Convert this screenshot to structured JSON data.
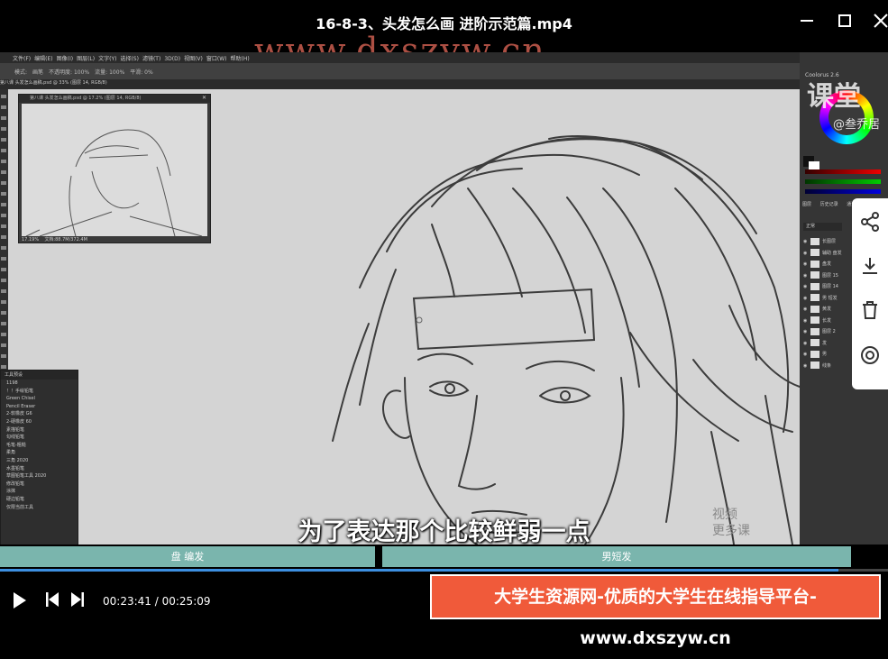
{
  "window": {
    "title": "16-8-3、头发怎么画 进阶示范篇.mp4",
    "minimize_icon": "minimize-icon",
    "maximize_icon": "maximize-icon",
    "close_icon": "close-icon"
  },
  "watermark_top": "www.dxszyw.cn",
  "app": {
    "menu": [
      "文件(F)",
      "编辑(E)",
      "图像(I)",
      "图层(L)",
      "文字(Y)",
      "选择(S)",
      "滤镜(T)",
      "3D(D)",
      "视图(V)",
      "窗口(W)",
      "帮助(H)"
    ],
    "options": [
      "模式:",
      "画笔",
      "不透明度: 100%",
      "流量: 100%",
      "平滑: 0%"
    ],
    "doc_tab": "第八课 头发怎么画稿.psd @ 33% (图层 14, RGB/8)",
    "navigator": {
      "title": "第八课 头发怎么画稿.psd @ 17.2% (图层 14, RGB/8)",
      "zoom": "17.19%",
      "doc_info": "文档:88.7M/372.4M"
    },
    "brush_panel": {
      "title": "工具预设",
      "items": [
        "1198",
        "！！手绘铅笔",
        "Green Chisel",
        "Pencil Eraser",
        "2-软橡皮 G6",
        "2-硬橡皮 60",
        "素描铅笔",
        "勾线铅笔",
        "毛笔-粗糙",
        "柔角",
        "三角 2020",
        "水墨铅笔",
        "草图铅笔工具 2020",
        "修改铅笔",
        "涂抹",
        "硬边铅笔",
        "仅限当前工具"
      ]
    },
    "right_panel": {
      "title": "Coolorus 2.6",
      "tabs": [
        "图层",
        "历史记录",
        "通道"
      ],
      "blend_mode": "正常",
      "layers": [
        "长图层",
        "辅助 盘发",
        "盘发",
        "图层 15",
        "图层 14",
        "男 短发",
        "黄发",
        "长发",
        "图层 2",
        "发",
        "男",
        "线条"
      ]
    }
  },
  "channel_logo": "课堂",
  "channel_handle": "@叁乔居",
  "side_buttons": [
    "share-icon",
    "download-icon",
    "delete-icon",
    "record-icon"
  ],
  "subtitle": "为了表达那个比较鲜弱一点",
  "corner_text": [
    "视频",
    "更多课"
  ],
  "chapters": [
    {
      "label": "盘 编发"
    },
    {
      "label": "男短发"
    }
  ],
  "player": {
    "progress": 0.944,
    "current_time": "00:23:41",
    "separator": "/",
    "total_time": "00:25:09"
  },
  "banner": "大学生资源网-优质的大学生在线指导平台-www.dxszyw.cn"
}
